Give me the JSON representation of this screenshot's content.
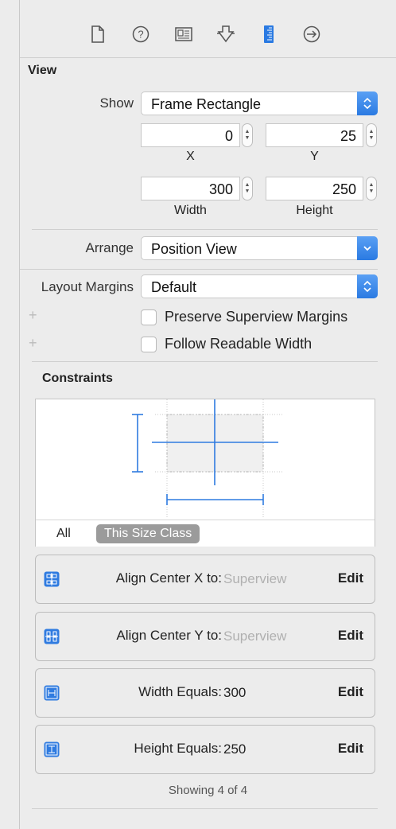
{
  "toolbar": {
    "icons": [
      "file-inspector-icon",
      "help-icon",
      "identity-inspector-icon",
      "attributes-inspector-icon",
      "size-inspector-icon",
      "connections-inspector-icon"
    ],
    "selected": "size-inspector-icon"
  },
  "view": {
    "title": "View",
    "show_label": "Show",
    "show_value": "Frame Rectangle",
    "x_value": "0",
    "y_value": "25",
    "x_label": "X",
    "y_label": "Y",
    "width_value": "300",
    "height_value": "250",
    "width_label": "Width",
    "height_label": "Height",
    "arrange_label": "Arrange",
    "arrange_value": "Position View",
    "layout_margins_label": "Layout Margins",
    "layout_margins_value": "Default",
    "preserve_label": "Preserve Superview Margins",
    "preserve_checked": false,
    "readable_label": "Follow Readable Width",
    "readable_checked": false,
    "plus": "+"
  },
  "constraints": {
    "title": "Constraints",
    "tab_all": "All",
    "tab_size_class": "This Size Class",
    "items": [
      {
        "attr": "Align Center X to:",
        "value": "Superview",
        "dim": true,
        "edit": "Edit",
        "icon": "align-center-x-icon"
      },
      {
        "attr": "Align Center Y to:",
        "value": "Superview",
        "dim": true,
        "edit": "Edit",
        "icon": "align-center-y-icon"
      },
      {
        "attr": "Width Equals:",
        "value": "300",
        "dim": false,
        "edit": "Edit",
        "icon": "width-constraint-icon"
      },
      {
        "attr": "Height Equals:",
        "value": "250",
        "dim": false,
        "edit": "Edit",
        "icon": "height-constraint-icon"
      }
    ],
    "footer": "Showing 4 of 4"
  },
  "colors": {
    "accent": "#2a7ae2",
    "constraint_line": "#2f7be0"
  }
}
